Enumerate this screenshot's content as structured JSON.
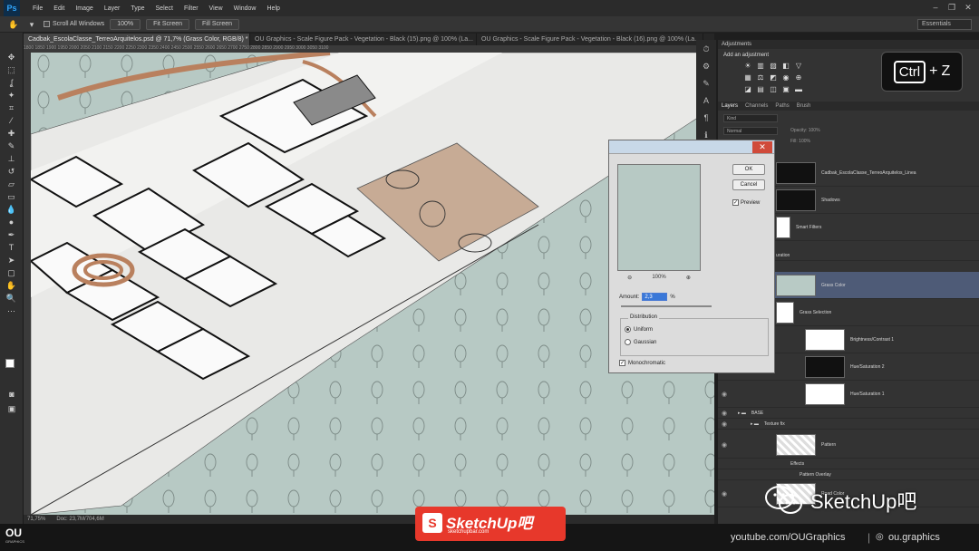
{
  "app": {
    "logo": "Ps"
  },
  "menu": [
    "File",
    "Edit",
    "Image",
    "Layer",
    "Type",
    "Select",
    "Filter",
    "View",
    "Window",
    "Help"
  ],
  "window_controls": [
    "–",
    "❐",
    "✕"
  ],
  "options": {
    "scroll_all_label": "Scroll All Windows",
    "btn_100": "100%",
    "btn_fit": "Fit Screen",
    "btn_fill": "Fill Screen",
    "workspace": "Essentials"
  },
  "tabs": [
    "Cadbak_EscolaClasse_TerreoArquitelos.psd @ 71,7% (Grass Color, RGB/8) *",
    "OU Graphics - Scale Figure Pack - Vegetation - Black (15).png @ 100% (La...",
    "OU Graphics - Scale Figure Pack - Vegetation - Black (16).png @ 100% (La..."
  ],
  "ruler_ticks": "1800   1850   1900   1950   2000   2050   2100   2150   2200   2250   2300   2350   2400   2450   2500   2550   2600   2650   2700   2750   2800   2850   2900   2950   3000   3050   3100",
  "status": {
    "zoom": "71,75%",
    "doc": "Doc: 23,7M/704,6M"
  },
  "adjustments": {
    "panel_label": "Adjustments",
    "title": "Add an adjustment"
  },
  "shortcut": {
    "key": "Ctrl",
    "plus": "+",
    "letter": "Z"
  },
  "layers_panel": {
    "tabs": [
      "Layers",
      "Channels",
      "Paths",
      "Brush"
    ],
    "kind": "Kind",
    "blend": "Normal",
    "opacity": "Opacity: 100%",
    "fill": "Fill: 100%",
    "layers": [
      {
        "name": "Cadbak_EscolaClasse_TerreoArquitelos_Linea"
      },
      {
        "name": "Shadows"
      },
      {
        "name": "Smart Filters"
      },
      {
        "name": "uration"
      },
      {
        "name": "Grass Color"
      },
      {
        "name": "Grass Selection"
      },
      {
        "name": "Brightness/Contrast 1"
      },
      {
        "name": "Hue/Saturation 2"
      },
      {
        "name": "Hue/Saturation 1"
      },
      {
        "name": "BASE"
      },
      {
        "name": "Texture fix"
      },
      {
        "name": "Pattern"
      },
      {
        "name": "Effects"
      },
      {
        "name": "Pattern Overlay"
      },
      {
        "name": "Road Color"
      }
    ]
  },
  "dialog": {
    "ok": "OK",
    "cancel": "Cancel",
    "preview": "Preview",
    "zoom": "100%",
    "amount_label": "Amount:",
    "amount_value": "2,3",
    "amount_unit": "%",
    "distribution": "Distribution",
    "uniform": "Uniform",
    "gaussian": "Gaussian",
    "monochromatic": "Monochromatic"
  },
  "footer": {
    "ou_logo": "OU",
    "ou_sub": "GRAPHICS",
    "youtube": "youtube.com/OUGraphics",
    "separator": "|",
    "instagram": "ou.graphics"
  },
  "watermark": {
    "sketchup_banner": "SketchUp吧",
    "sketchup_url": "sketchupbar.com",
    "wechat_label": "SketchUp吧"
  },
  "colors": {
    "canvas": "#b7c9c4",
    "accent_brown": "#b9805e",
    "layer_selected": "#4e5b77",
    "sketchup_red": "#e7382b"
  }
}
